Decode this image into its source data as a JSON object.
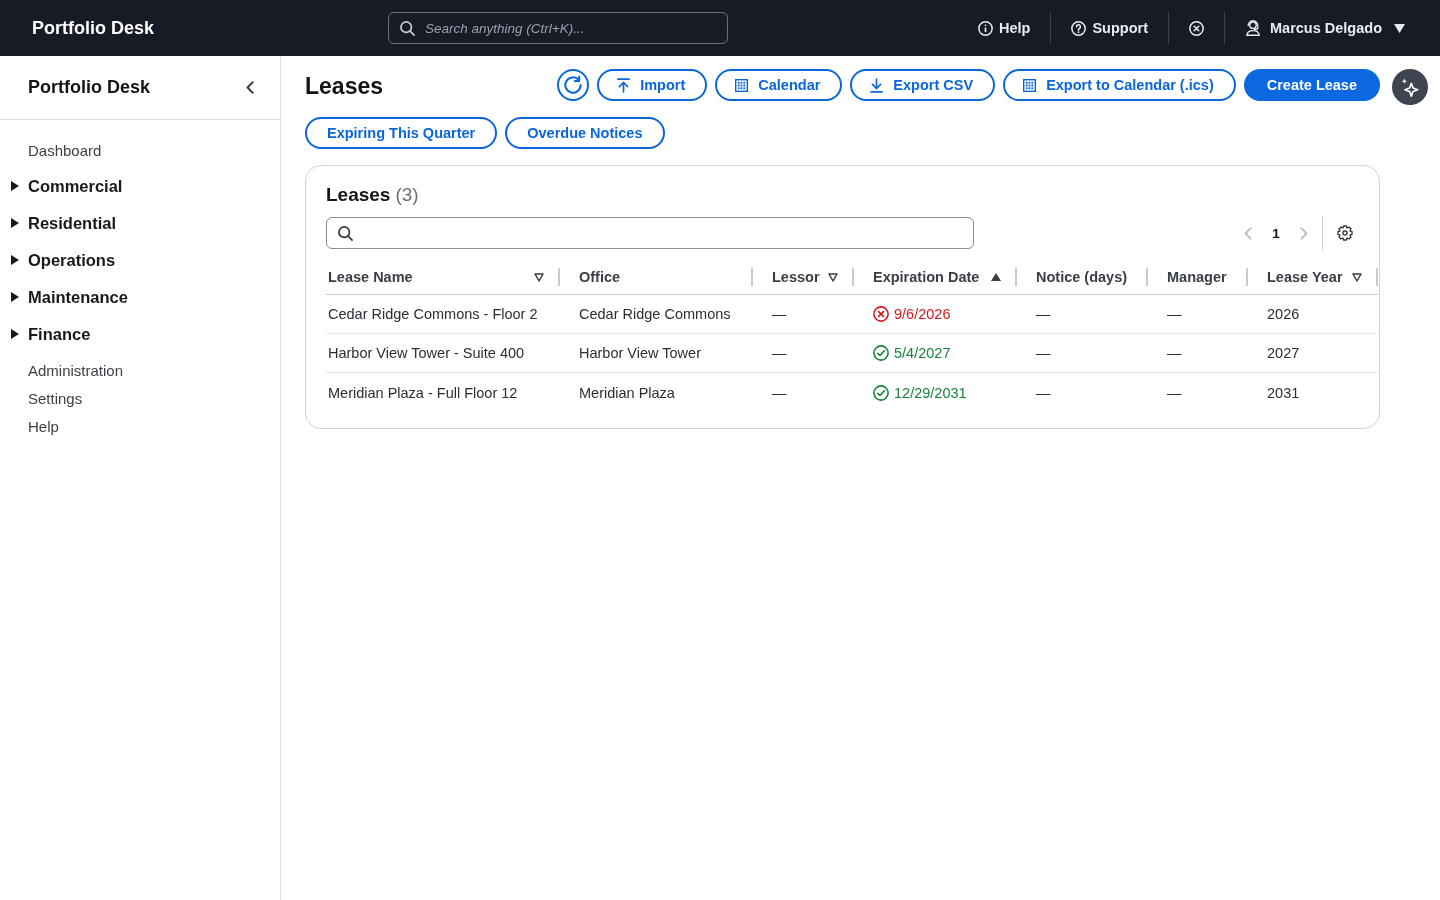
{
  "topbar": {
    "brand": "Portfolio Desk",
    "search": {
      "placeholder": "Search anything (Ctrl+K)..."
    },
    "links": [
      {
        "kind": "info",
        "label": "Help"
      },
      {
        "kind": "question",
        "label": "Support"
      },
      {
        "kind": "close"
      }
    ],
    "user": {
      "name": "Marcus Delgado"
    }
  },
  "sidebar": {
    "title": "Portfolio Desk",
    "items": [
      {
        "kind": "link",
        "label": "Dashboard"
      },
      {
        "kind": "group",
        "label": "Commercial",
        "expanded": false
      },
      {
        "kind": "group",
        "label": "Residential",
        "expanded": false
      },
      {
        "kind": "group",
        "label": "Operations",
        "expanded": false
      },
      {
        "kind": "group",
        "label": "Maintenance",
        "expanded": false
      },
      {
        "kind": "group",
        "label": "Finance",
        "expanded": false
      },
      {
        "kind": "link",
        "label": "Administration"
      },
      {
        "kind": "link",
        "label": "Settings"
      },
      {
        "kind": "link",
        "label": "Help"
      }
    ]
  },
  "page": {
    "title": "Leases",
    "actions": [
      {
        "kind": "refresh"
      },
      {
        "kind": "import",
        "label": "Import"
      },
      {
        "kind": "calendar",
        "label": "Calendar"
      },
      {
        "kind": "export",
        "label": "Export CSV"
      },
      {
        "kind": "calendar",
        "label": "Export to Calendar (.ics)"
      },
      {
        "kind": "primary",
        "label": "Create Lease"
      },
      {
        "kind": "assistant"
      }
    ],
    "quick_filters": [
      {
        "label": "Expiring This Quarter",
        "selected": false
      },
      {
        "label": "Overdue Notices",
        "selected": false
      }
    ]
  },
  "table": {
    "title": "Leases",
    "count": "(3)",
    "pager": {
      "page": "1",
      "previous": {
        "disabled": true
      },
      "next": {
        "disabled": true
      }
    },
    "columns": [
      {
        "label": "Lease Name",
        "filter": true,
        "sorted": false
      },
      {
        "label": "Office",
        "filter": false,
        "sorted": false
      },
      {
        "label": "Lessor",
        "filter": true,
        "sorted": false
      },
      {
        "label": "Expiration Date",
        "filter": false,
        "sorted": true
      },
      {
        "label": "Notice (days)",
        "filter": false,
        "sorted": false
      },
      {
        "label": "Manager",
        "filter": false,
        "sorted": false
      },
      {
        "label": "Lease Year",
        "filter": true,
        "sorted": false
      }
    ],
    "rows": [
      {
        "cells": [
          {
            "text": "Cedar Ridge Commons - Floor 2"
          },
          {
            "text": "Cedar Ridge Commons"
          },
          {
            "text": "—"
          },
          {
            "text": "9/6/2026",
            "kind": "date",
            "expired": true
          },
          {
            "text": "—"
          },
          {
            "text": "—"
          },
          {
            "text": "2026"
          }
        ]
      },
      {
        "cells": [
          {
            "text": "Harbor View Tower - Suite 400"
          },
          {
            "text": "Harbor View Tower"
          },
          {
            "text": "—"
          },
          {
            "text": "5/4/2027",
            "kind": "date",
            "expired": false
          },
          {
            "text": "—"
          },
          {
            "text": "—"
          },
          {
            "text": "2027"
          }
        ]
      },
      {
        "cells": [
          {
            "text": "Meridian Plaza - Full Floor 12"
          },
          {
            "text": "Meridian Plaza"
          },
          {
            "text": "—"
          },
          {
            "text": "12/29/2031",
            "kind": "date",
            "expired": false
          },
          {
            "text": "—"
          },
          {
            "text": "—"
          },
          {
            "text": "2031"
          }
        ]
      }
    ]
  }
}
